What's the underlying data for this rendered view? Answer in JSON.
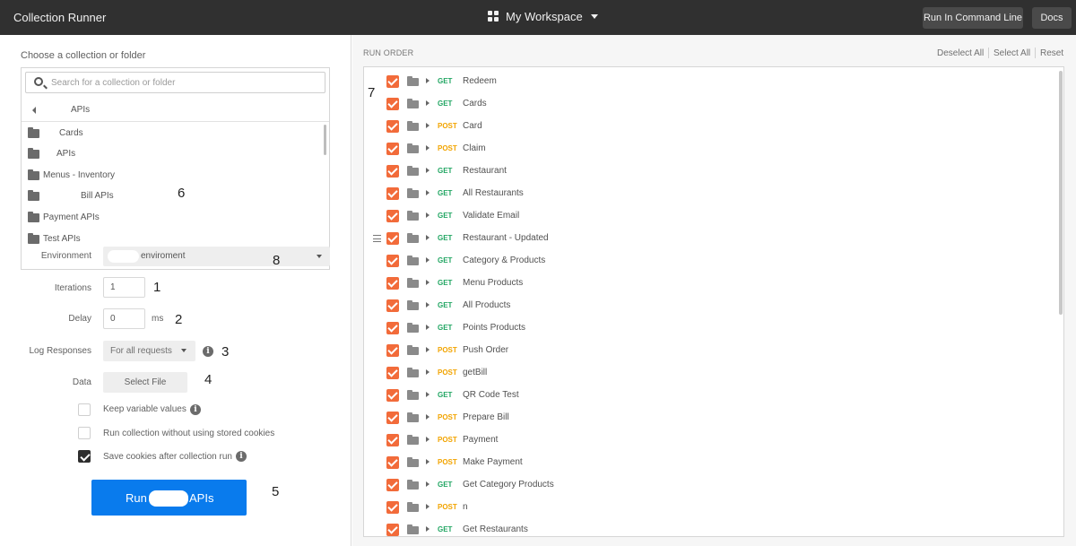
{
  "header": {
    "app_title": "Collection Runner",
    "workspace": "My Workspace",
    "run_cmd_label": "Run In Command Line",
    "docs_label": "Docs",
    "workspace_icon": "grid-icon",
    "bg_color": "#303030"
  },
  "collection_picker": {
    "label": "Choose a collection or folder",
    "search_placeholder": "Search for a collection or folder",
    "breadcrumb": "APIs",
    "folders": [
      "Cards",
      "APIs",
      "Menus - Inventory",
      "Bill APIs",
      "Payment APIs",
      "Test APIs"
    ]
  },
  "environment": {
    "label": "Environment",
    "value": "enviroment"
  },
  "iterations": {
    "label": "Iterations",
    "value": "1"
  },
  "delay": {
    "label": "Delay",
    "value": "0",
    "unit": "ms"
  },
  "log_responses": {
    "label": "Log Responses",
    "value": "For all requests"
  },
  "data": {
    "label": "Data",
    "button": "Select File"
  },
  "options": {
    "keep_variables": {
      "label": "Keep variable values",
      "checked": false
    },
    "no_cookies": {
      "label": "Run collection without using stored cookies",
      "checked": false
    },
    "save_cookies": {
      "label": "Save cookies after collection run",
      "checked": true
    }
  },
  "run_button": {
    "prefix": "Run",
    "suffix": "APIs",
    "color": "#097bed"
  },
  "annotations": [
    "1",
    "2",
    "3",
    "4",
    "5",
    "6",
    "7",
    "8"
  ],
  "run_order": {
    "title": "RUN ORDER",
    "deselect_all": "Deselect All",
    "select_all": "Select All",
    "reset": "Reset",
    "check_color": "#f26b3a",
    "get_color": "#22a663",
    "post_color": "#f2a400",
    "requests": [
      {
        "method": "GET",
        "name": "Redeem"
      },
      {
        "method": "GET",
        "name": "Cards"
      },
      {
        "method": "POST",
        "name": "Card"
      },
      {
        "method": "POST",
        "name": "Claim"
      },
      {
        "method": "GET",
        "name": "Restaurant"
      },
      {
        "method": "GET",
        "name": "All Restaurants"
      },
      {
        "method": "GET",
        "name": "Validate Email"
      },
      {
        "method": "GET",
        "name": "Restaurant - Updated"
      },
      {
        "method": "GET",
        "name": "Category & Products"
      },
      {
        "method": "GET",
        "name": "Menu Products"
      },
      {
        "method": "GET",
        "name": "All Products"
      },
      {
        "method": "GET",
        "name": "Points Products"
      },
      {
        "method": "POST",
        "name": "Push Order"
      },
      {
        "method": "POST",
        "name": "getBill"
      },
      {
        "method": "GET",
        "name": "QR Code Test"
      },
      {
        "method": "POST",
        "name": "Prepare Bill"
      },
      {
        "method": "POST",
        "name": "Payment"
      },
      {
        "method": "POST",
        "name": "Make Payment"
      },
      {
        "method": "GET",
        "name": "Get Category Products"
      },
      {
        "method": "POST",
        "name": "n"
      },
      {
        "method": "GET",
        "name": "Get Restaurants"
      }
    ]
  }
}
